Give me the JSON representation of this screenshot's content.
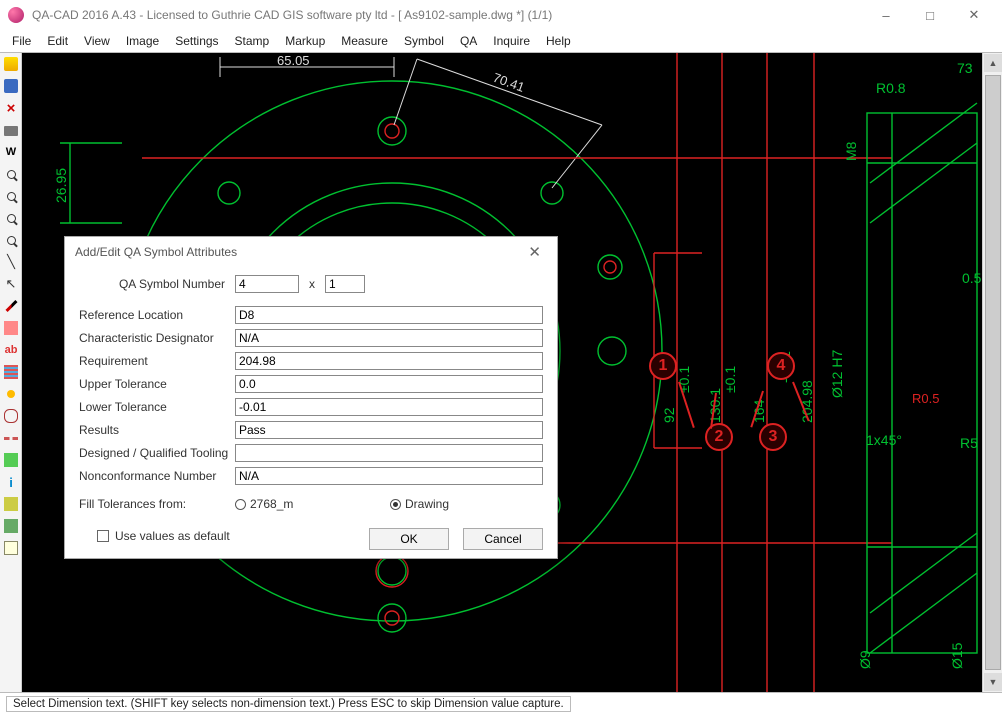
{
  "title": "QA-CAD 2016 A.43 - Licensed to Guthrie CAD GIS software pty ltd  -  [ As9102-sample.dwg *] (1/1)",
  "menus": [
    "File",
    "Edit",
    "View",
    "Image",
    "Settings",
    "Stamp",
    "Markup",
    "Measure",
    "Symbol",
    "QA",
    "Inquire",
    "Help"
  ],
  "toolbar_icons": [
    "open-icon",
    "save-icon",
    "close-doc-icon",
    "print-icon",
    "wrap-icon",
    "zoom-in-icon",
    "zoom-fit-icon",
    "zoom-out-icon",
    "zoom-window-icon",
    "line-icon",
    "pointer-icon",
    "pencil-icon",
    "erase-icon",
    "text-ab-icon",
    "layers-icon",
    "color-icon",
    "cloud-icon",
    "dash-icon",
    "dim-icon",
    "info-icon",
    "tag-icon",
    "pin-icon",
    "table-icon"
  ],
  "cad": {
    "dim_6505": "65.05",
    "dim_7041": "70.41",
    "dim_2695": "26.95",
    "dim_73": "73",
    "dim_92": "92",
    "dim_1301": "130.1",
    "dim_164": "164",
    "dim_20498": "204.98",
    "tol_p01": "±0.1",
    "tol_p01b": "±0.1",
    "tol_n001": "-0.01",
    "note_1x45": "1x45°",
    "note_r5": "R5",
    "note_m8": "M8",
    "note_r08": "R0.8",
    "note_r05": "R0.5",
    "note_05": "0.5",
    "note_phi12h7": "Ø12 H7",
    "note_phi9": "Ø9",
    "note_phi15": "Ø15",
    "balloons": [
      "1",
      "2",
      "3",
      "4"
    ]
  },
  "dialog": {
    "title": "Add/Edit QA Symbol Attributes",
    "labels": {
      "qa_number": "QA Symbol Number",
      "ref_loc": "Reference Location",
      "char_desig": "Characteristic Designator",
      "requirement": "Requirement",
      "upper_tol": "Upper Tolerance",
      "lower_tol": "Lower Tolerance",
      "results": "Results",
      "tooling": "Designed / Qualified Tooling",
      "nonconf": "Nonconformance Number",
      "fill_from": "Fill Tolerances from:",
      "use_default": "Use values as default"
    },
    "values": {
      "qa_number_a": "4",
      "qa_number_b": "1",
      "ref_loc": "D8",
      "char_desig": "N/A",
      "requirement": "204.98",
      "upper_tol": "0.0",
      "lower_tol": "-0.01",
      "results": "Pass",
      "tooling": "",
      "nonconf": "N/A"
    },
    "radio_a": "2768_m",
    "radio_b": "Drawing",
    "ok": "OK",
    "cancel": "Cancel",
    "x_sep": "x"
  },
  "statusbar": "Select Dimension text. (SHIFT key selects non-dimension text.) Press ESC to skip Dimension value capture."
}
